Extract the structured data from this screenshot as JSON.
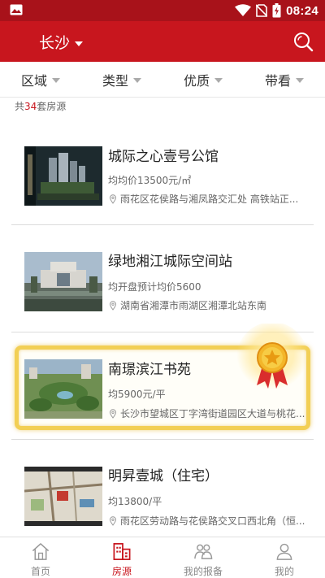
{
  "status_bar": {
    "time": "08:24",
    "icons": [
      "image-icon",
      "wifi-icon",
      "no-sim-icon",
      "battery-icon"
    ]
  },
  "header": {
    "city": "长沙",
    "search_icon": "search-icon"
  },
  "filters": [
    {
      "label": "区域"
    },
    {
      "label": "类型"
    },
    {
      "label": "优质"
    },
    {
      "label": "带看"
    }
  ],
  "summary": {
    "prefix": "共",
    "count": "34",
    "suffix": "套房源"
  },
  "listings": [
    {
      "name": "城际之心壹号公馆",
      "price": "均均价13500元/㎡",
      "address": "雨花区花侯路与湘凤路交汇处 高铁站正...",
      "featured": false
    },
    {
      "name": "绿地湘江城际空间站",
      "price": "均开盘预计均价5600",
      "address": "湖南省湘潭市雨湖区湘潭北站东南",
      "featured": false
    },
    {
      "name": "南璟滨江书苑",
      "price": "均5900元/平",
      "address": "长沙市望城区丁字湾街道园区大道与桃花...",
      "featured": true
    },
    {
      "name": "明昇壹城（住宅）",
      "price": "均13800/平",
      "address": "雨花区劳动路与花侯路交叉口西北角（恒...",
      "featured": false
    }
  ],
  "tabbar": [
    {
      "label": "首页",
      "icon": "home-icon",
      "active": false
    },
    {
      "label": "房源",
      "icon": "building-icon",
      "active": true
    },
    {
      "label": "我的报备",
      "icon": "users-icon",
      "active": false
    },
    {
      "label": "我的",
      "icon": "person-icon",
      "active": false
    }
  ],
  "colors": {
    "brand": "#c8161e",
    "status_bar": "#a8121a",
    "featured_border": "#f2cf55"
  }
}
